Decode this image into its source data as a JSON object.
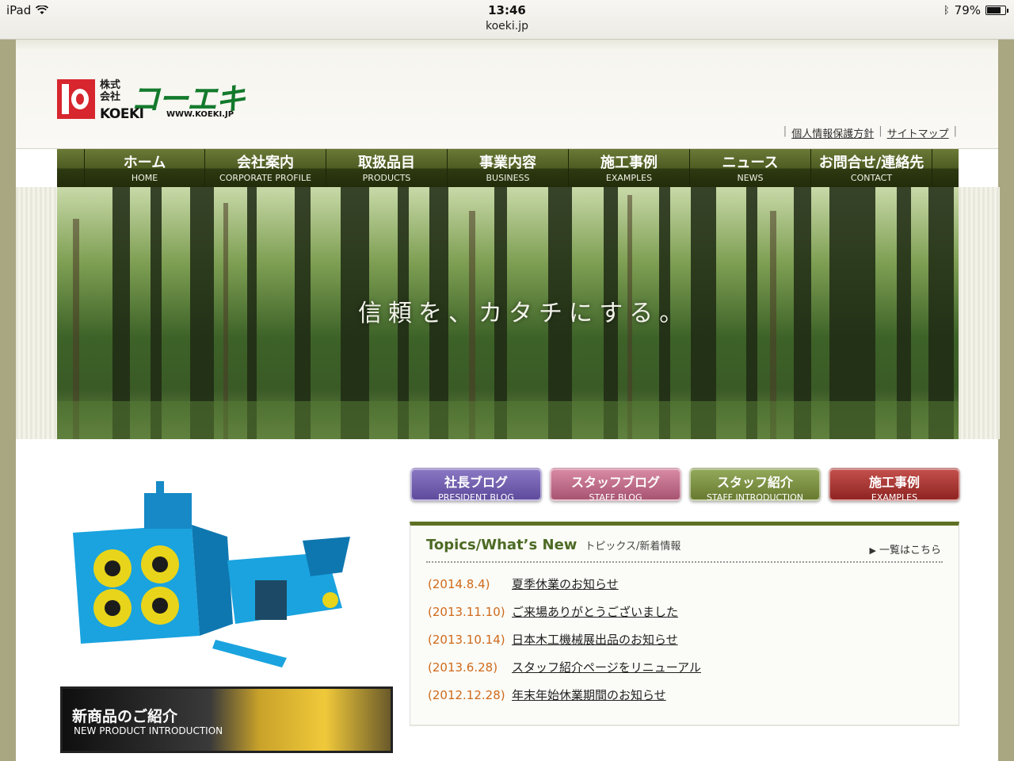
{
  "status_bar": {
    "device": "iPad",
    "time": "13:46",
    "url": "koeki.jp",
    "battery": "79%",
    "battery_level": 0.79
  },
  "header": {
    "logo": {
      "kabushiki": "株式会社",
      "name": "コーエキ",
      "english": "KOEKI",
      "url": "WWW.KOEKI.JP"
    },
    "links": [
      {
        "label": "個人情報保護方針"
      },
      {
        "label": "サイトマップ"
      }
    ]
  },
  "nav": [
    {
      "jp": "ホーム",
      "en": "HOME"
    },
    {
      "jp": "会社案内",
      "en": "CORPORATE PROFILE"
    },
    {
      "jp": "取扱品目",
      "en": "PRODUCTS"
    },
    {
      "jp": "事業内容",
      "en": "BUSINESS"
    },
    {
      "jp": "施工事例",
      "en": "EXAMPLES"
    },
    {
      "jp": "ニュース",
      "en": "NEWS"
    },
    {
      "jp": "お問合せ/連絡先",
      "en": "CONTACT"
    }
  ],
  "hero": {
    "tagline": "信頼を、カタチにする。"
  },
  "promo": {
    "jp": "新商品のご紹介",
    "en": "NEW PRODUCT INTRODUCTION"
  },
  "buttons": [
    {
      "jp": "社長ブログ",
      "en": "PRESIDENT BLOG"
    },
    {
      "jp": "スタッフブログ",
      "en": "STAFF BLOG"
    },
    {
      "jp": "スタッフ紹介",
      "en": "STAFF INTRODUCTION"
    },
    {
      "jp": "施工事例",
      "en": "EXAMPLES"
    }
  ],
  "topics": {
    "title": "Topics/What’s New",
    "subtitle": "トピックス/新着情報",
    "more": "一覧はこちら",
    "items": [
      {
        "date": "(2014.8.4)",
        "title": "夏季休業のお知らせ"
      },
      {
        "date": "(2013.11.10)",
        "title": "ご来場ありがとうございました"
      },
      {
        "date": "(2013.10.14)",
        "title": "日本木工機械展出品のお知らせ"
      },
      {
        "date": "(2013.6.28)",
        "title": "スタッフ紹介ページをリニューアル"
      },
      {
        "date": "(2012.12.28)",
        "title": "年末年始休業期間のお知らせ"
      }
    ]
  }
}
